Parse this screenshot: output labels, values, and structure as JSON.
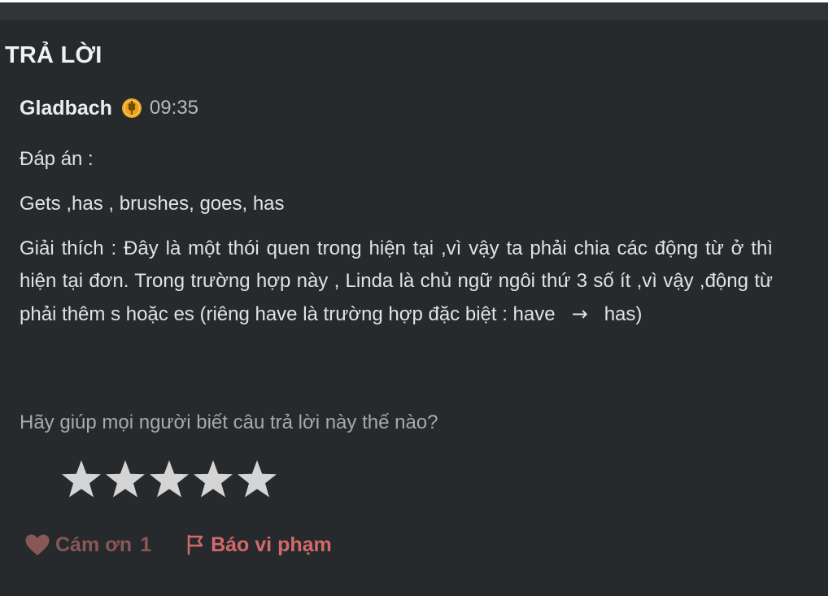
{
  "section": {
    "title": "TRẢ LỜI"
  },
  "answer": {
    "author": "Gladbach",
    "badge_icon": "wheat-rank-badge-icon",
    "time": "09:35",
    "answer_label": "Đáp án :",
    "answer_text": "Gets ,has , brushes, goes, has",
    "explanation_before_arrow": "Giải thích : Đây là một thói quen trong hiện tại ,vì vậy ta phải chia các động từ ở thì hiện tại đơn. Trong trường hợp này , Linda là chủ ngữ ngôi thứ 3 số ít ,vì vậy ,động từ phải thêm s hoặc es (riêng have là trường hợp đặc biệt : have",
    "explanation_arrow": "→",
    "explanation_after_arrow": "has)"
  },
  "rating": {
    "prompt": "Hãy giúp mọi người biết câu trả lời này thế nào?",
    "max_stars": 5,
    "current_stars": 0,
    "star_icon": "star-icon"
  },
  "actions": {
    "thanks_label": "Cám ơn",
    "thanks_count": "1",
    "report_label": "Báo vi phạm",
    "thanks_icon": "heart-icon",
    "report_icon": "flag-icon"
  },
  "colors": {
    "background": "#262a2c",
    "top_bar": "#2f3539",
    "star": "#d4d4d4",
    "badge": "#e8a21b",
    "thanks": "#8a5757",
    "report": "#d26a6a"
  }
}
